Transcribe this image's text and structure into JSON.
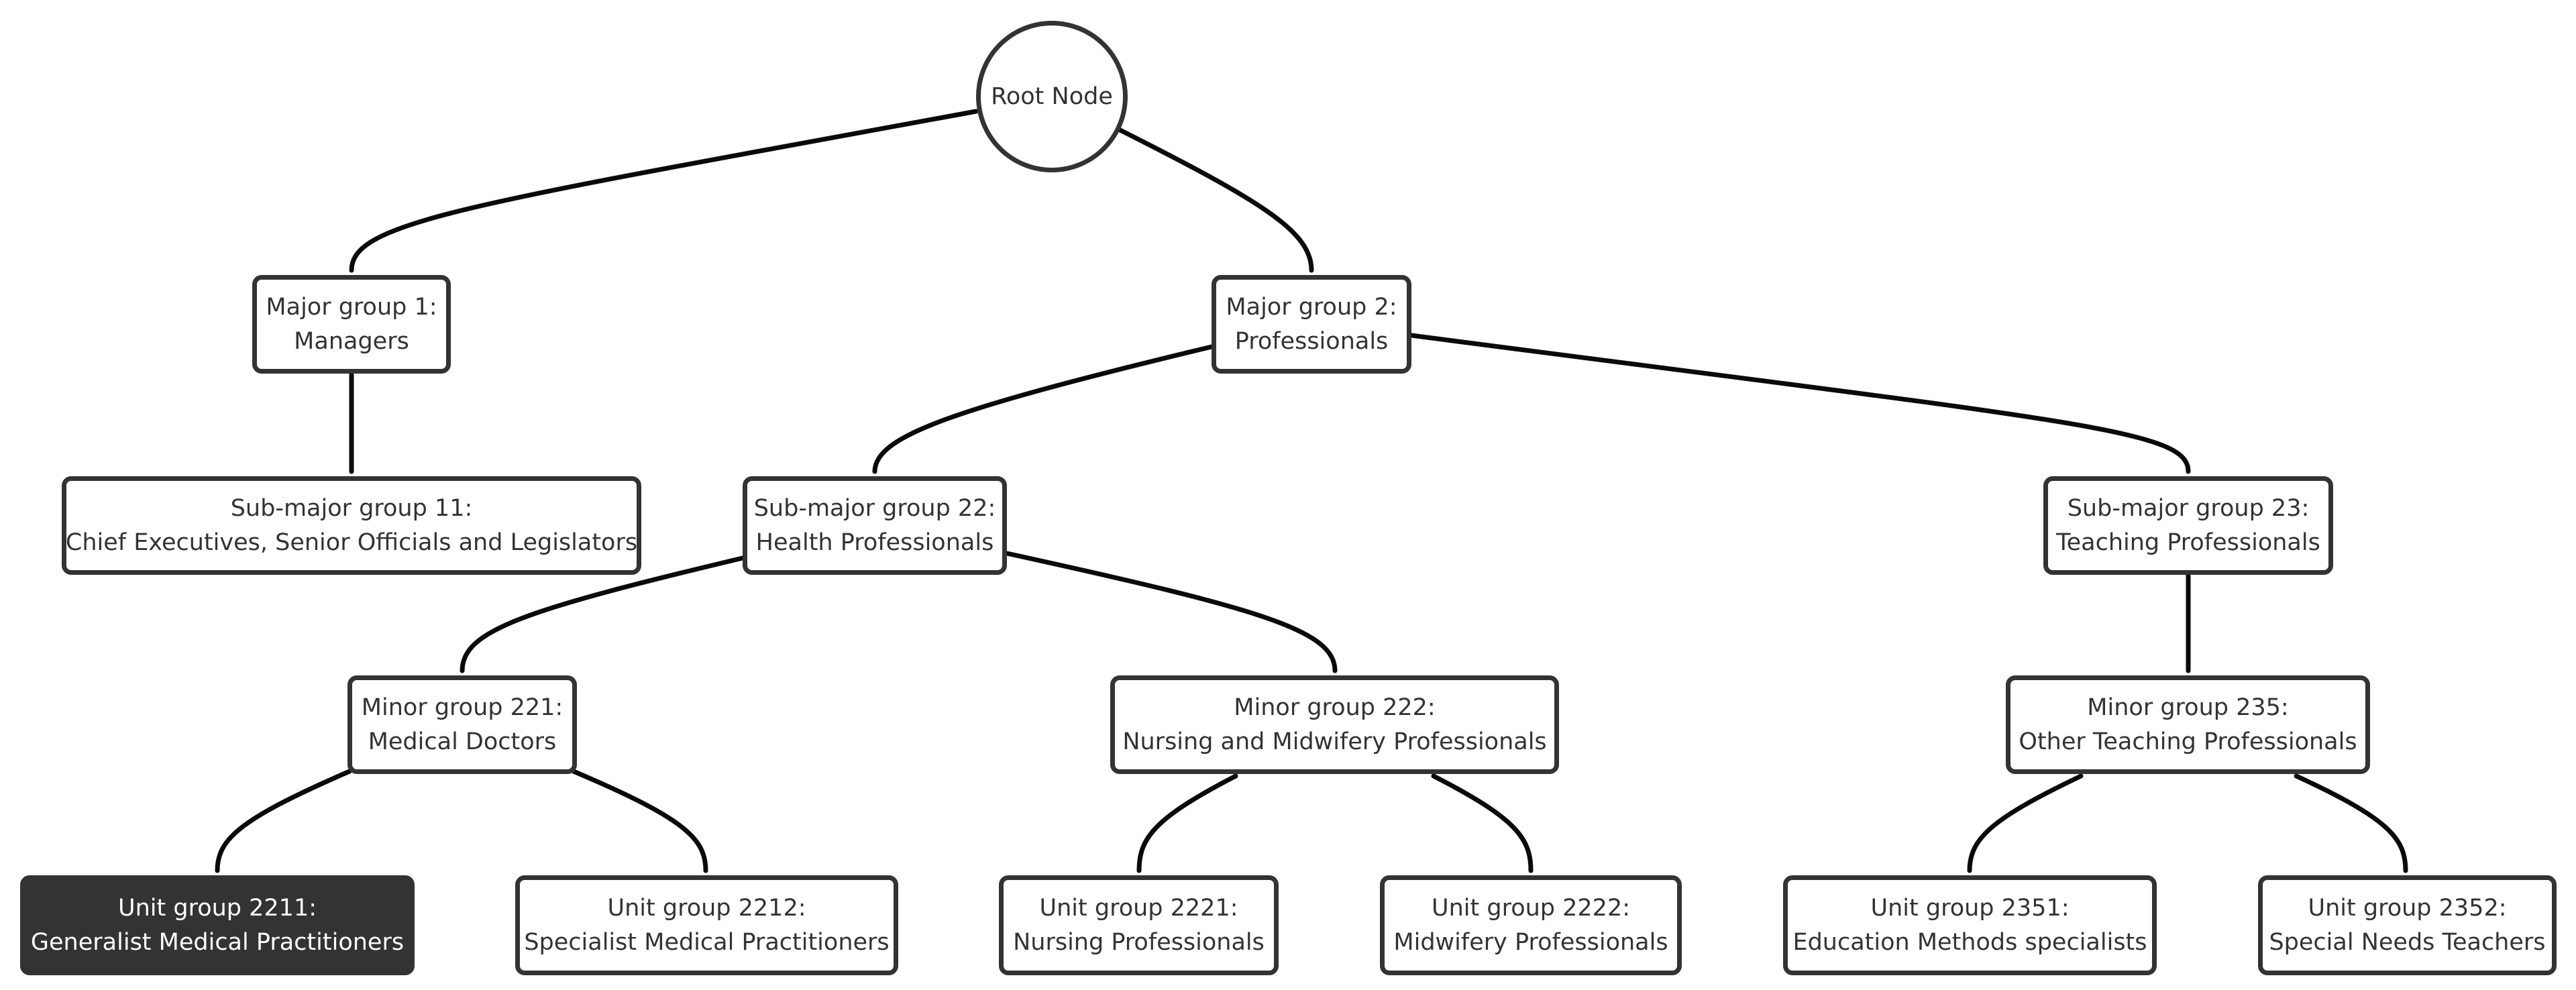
{
  "diagram": {
    "type": "tree",
    "colors": {
      "node_border": "#333333",
      "node_fill": "#ffffff",
      "text": "#333333",
      "selected_fill": "#333333",
      "selected_text": "#ffffff",
      "edge": "#0a0a0a"
    },
    "nodes": [
      {
        "id": "root",
        "parent": null,
        "lines": [
          "Root Node"
        ]
      },
      {
        "id": "mg1",
        "parent": "root",
        "lines": [
          "Major group 1:",
          "Managers"
        ]
      },
      {
        "id": "mg2",
        "parent": "root",
        "lines": [
          "Major group 2:",
          "Professionals"
        ]
      },
      {
        "id": "sm11",
        "parent": "mg1",
        "lines": [
          "Sub-major group 11:",
          "Chief Executives, Senior Officials and Legislators"
        ]
      },
      {
        "id": "sm22",
        "parent": "mg2",
        "lines": [
          "Sub-major group 22:",
          "Health Professionals"
        ]
      },
      {
        "id": "sm23",
        "parent": "mg2",
        "lines": [
          "Sub-major group 23:",
          "Teaching Professionals"
        ]
      },
      {
        "id": "mn221",
        "parent": "sm22",
        "lines": [
          "Minor group 221:",
          "Medical Doctors"
        ]
      },
      {
        "id": "mn222",
        "parent": "sm22",
        "lines": [
          "Minor group 222:",
          "Nursing and Midwifery Professionals"
        ]
      },
      {
        "id": "mn235",
        "parent": "sm23",
        "lines": [
          "Minor group 235:",
          "Other Teaching Professionals"
        ]
      },
      {
        "id": "u2211",
        "parent": "mn221",
        "lines": [
          "Unit group 2211:",
          "Generalist Medical Practitioners"
        ],
        "selected": true
      },
      {
        "id": "u2212",
        "parent": "mn221",
        "lines": [
          "Unit group 2212:",
          "Specialist Medical Practitioners"
        ]
      },
      {
        "id": "u2221",
        "parent": "mn222",
        "lines": [
          "Unit group 2221:",
          "Nursing Professionals"
        ]
      },
      {
        "id": "u2222",
        "parent": "mn222",
        "lines": [
          "Unit group 2222:",
          "Midwifery Professionals"
        ]
      },
      {
        "id": "u2351",
        "parent": "mn235",
        "lines": [
          "Unit group 2351:",
          "Education Methods specialists"
        ]
      },
      {
        "id": "u2352",
        "parent": "mn235",
        "lines": [
          "Unit group 2352:",
          "Special Needs Teachers"
        ]
      }
    ]
  }
}
